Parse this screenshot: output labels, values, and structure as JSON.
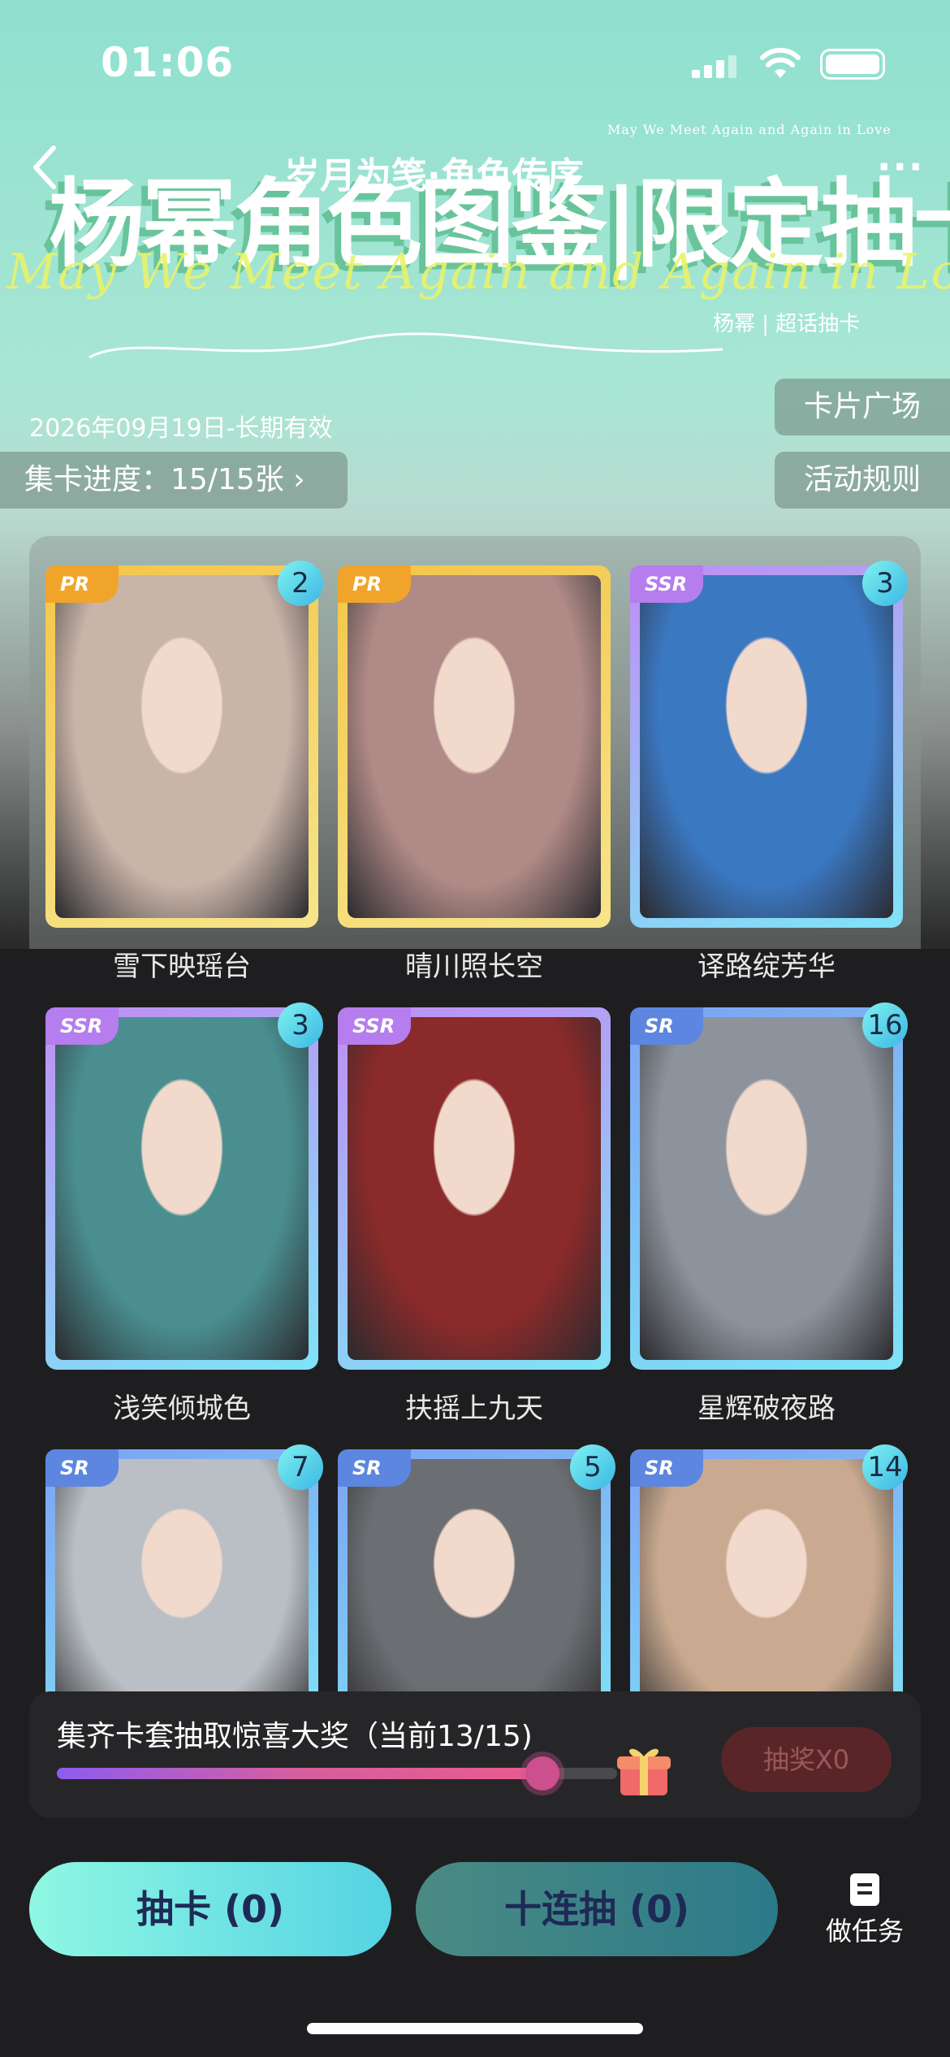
{
  "status_bar": {
    "time": "01:06"
  },
  "nav": {
    "title": "岁月为笺·角色传序",
    "more": "···"
  },
  "banner": {
    "title": "杨幂角色图鉴|限定抽卡",
    "tagline": "May We Meet Again and Again in Love",
    "script": "May We Meet Again and Again in Love",
    "sub": "杨幂 | 超话抽卡"
  },
  "validity": "2026年09月19日-长期有效",
  "progress_pill": "集卡进度：15/15张 ›",
  "side_buttons": {
    "plaza": "卡片广场",
    "rules": "活动规则"
  },
  "cards": [
    {
      "name": "雪下映瑶台",
      "rarity": "PR",
      "count": "2",
      "frame": "#f3c64a",
      "frame2": "#f7e58a",
      "tag": "#f0a52a",
      "img": "#c9b4a8"
    },
    {
      "name": "晴川照长空",
      "rarity": "PR",
      "count": "",
      "frame": "#f3c64a",
      "frame2": "#f7e58a",
      "tag": "#f0a52a",
      "img": "#b08a86"
    },
    {
      "name": "译路绽芳华",
      "rarity": "SSR",
      "count": "3",
      "frame": "#c08ef3",
      "frame2": "#7fe3f7",
      "tag": "#b57ded",
      "img": "#3b78c2"
    },
    {
      "name": "浅笑倾城色",
      "rarity": "SSR",
      "count": "3",
      "frame": "#c08ef3",
      "frame2": "#7fe3f7",
      "tag": "#b57ded",
      "img": "#4a8e90"
    },
    {
      "name": "扶摇上九天",
      "rarity": "SSR",
      "count": "",
      "frame": "#c08ef3",
      "frame2": "#7fe3f7",
      "tag": "#b57ded",
      "img": "#8a2a2a"
    },
    {
      "name": "星辉破夜路",
      "rarity": "SR",
      "count": "16",
      "frame": "#7ea2f3",
      "frame2": "#7fe3f7",
      "tag": "#5d86e0",
      "img": "#8d939c"
    },
    {
      "name": "",
      "rarity": "SR",
      "count": "7",
      "frame": "#7ea2f3",
      "frame2": "#7fe3f7",
      "tag": "#5d86e0",
      "img": "#b9bfc4"
    },
    {
      "name": "",
      "rarity": "SR",
      "count": "5",
      "frame": "#7ea2f3",
      "frame2": "#7fe3f7",
      "tag": "#5d86e0",
      "img": "#6b6e72"
    },
    {
      "name": "",
      "rarity": "SR",
      "count": "14",
      "frame": "#7ea2f3",
      "frame2": "#7fe3f7",
      "tag": "#5d86e0",
      "img": "#c9aa90"
    }
  ],
  "bonus": {
    "text": "集齐卡套抽取惊喜大奖（当前13/15)",
    "progress": 0.8667,
    "raffle_label": "抽奖X0"
  },
  "actions": {
    "draw_one": "抽卡 (0)",
    "draw_ten": "十连抽 (0)",
    "tasks": "做任务"
  }
}
